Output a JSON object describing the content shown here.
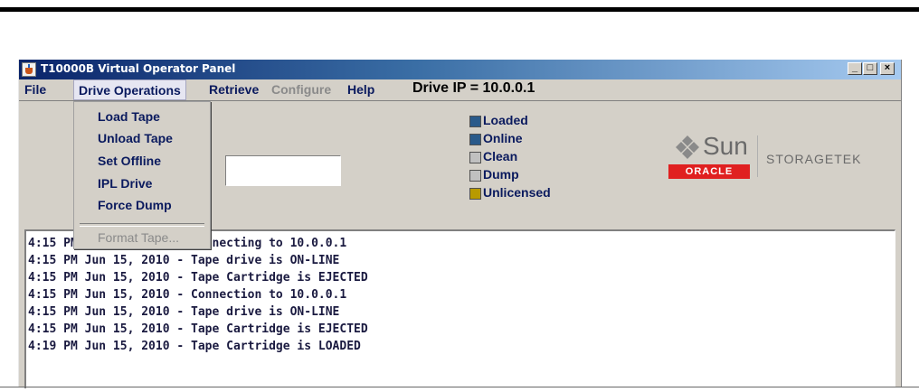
{
  "window": {
    "title": "T10000B Virtual Operator Panel",
    "icon": "java-cup-icon",
    "controls": {
      "minimize": "_",
      "maximize": "□",
      "close": "×"
    }
  },
  "menubar": {
    "file": "File",
    "drive_operations": "Drive Operations",
    "retrieve": "Retrieve",
    "configure": "Configure",
    "help": "Help"
  },
  "drive_ip": "Drive IP = 10.0.0.1",
  "drive_ops_menu": {
    "items": [
      "Load Tape",
      "Unload Tape",
      "Set Offline",
      "IPL Drive",
      "Force Dump"
    ],
    "disabled_item": "Format Tape..."
  },
  "text_field": {
    "value": ""
  },
  "status": [
    {
      "label": "Loaded",
      "color": "#2a5a8a"
    },
    {
      "label": "Online",
      "color": "#2a5a8a"
    },
    {
      "label": "Clean",
      "color": "#c0c0c0"
    },
    {
      "label": "Dump",
      "color": "#c0c0c0"
    },
    {
      "label": "Unlicensed",
      "color": "#b89a00"
    }
  ],
  "logo": {
    "sun": "Sun",
    "oracle": "ORACLE",
    "storagetek": "STORAGETEK"
  },
  "log": [
    "4:15 PM Jun 15, 2010 - Connecting to 10.0.0.1",
    "4:15 PM Jun 15, 2010 - Tape drive is ON-LINE",
    "4:15 PM Jun 15, 2010 - Tape Cartridge is EJECTED",
    "4:15 PM Jun 15, 2010 - Connection to 10.0.0.1",
    "4:15 PM Jun 15, 2010 - Tape drive is ON-LINE",
    "4:15 PM Jun 15, 2010 - Tape Cartridge is EJECTED",
    "4:19 PM Jun 15, 2010 - Tape Cartridge is LOADED"
  ]
}
